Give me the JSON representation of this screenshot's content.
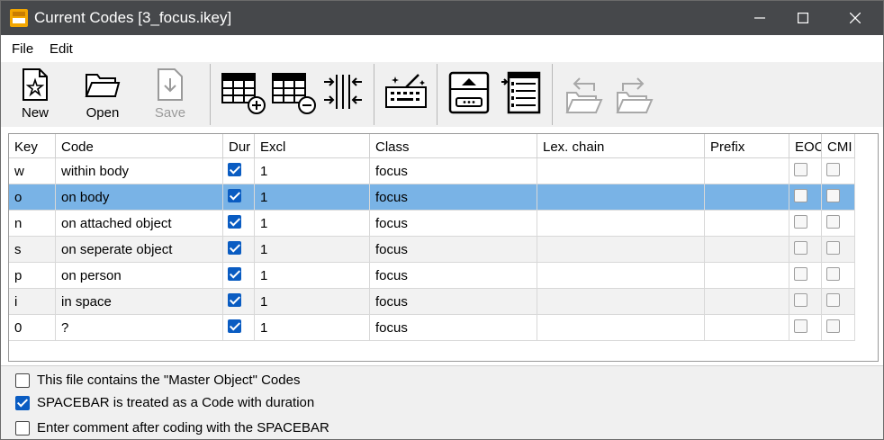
{
  "window": {
    "title": "Current Codes [3_focus.ikey]",
    "controls": [
      "minimize-icon",
      "maximize-icon",
      "close-icon"
    ]
  },
  "menu": {
    "file": "File",
    "edit": "Edit"
  },
  "toolbar": {
    "new": "New",
    "open": "Open",
    "save": "Save",
    "icons": [
      "new-file-star-icon",
      "open-folder-icon",
      "save-download-icon",
      "add-row-grid-icon",
      "remove-row-grid-icon",
      "column-arrows-icon",
      "magic-wand-keyboard-icon",
      "import-box-icon",
      "export-table-icon",
      "undo-folder-icon",
      "redo-folder-icon"
    ]
  },
  "grid": {
    "headers": [
      "Key",
      "Code",
      "Dur",
      "Excl",
      "Class",
      "Lex. chain",
      "Prefix",
      "EOC",
      "CMI"
    ],
    "rows": [
      {
        "key": "w",
        "code": "within body",
        "dur": true,
        "excl": "1",
        "class": "focus",
        "lex": "",
        "prefix": "",
        "eoc": false,
        "cmi": false
      },
      {
        "key": "o",
        "code": "on body",
        "dur": true,
        "excl": "1",
        "class": "focus",
        "lex": "",
        "prefix": "",
        "eoc": false,
        "cmi": false
      },
      {
        "key": "n",
        "code": "on attached object",
        "dur": true,
        "excl": "1",
        "class": "focus",
        "lex": "",
        "prefix": "",
        "eoc": false,
        "cmi": false
      },
      {
        "key": "s",
        "code": "on seperate object",
        "dur": true,
        "excl": "1",
        "class": "focus",
        "lex": "",
        "prefix": "",
        "eoc": false,
        "cmi": false
      },
      {
        "key": "p",
        "code": "on person",
        "dur": true,
        "excl": "1",
        "class": "focus",
        "lex": "",
        "prefix": "",
        "eoc": false,
        "cmi": false
      },
      {
        "key": "i",
        "code": "in space",
        "dur": true,
        "excl": "1",
        "class": "focus",
        "lex": "",
        "prefix": "",
        "eoc": false,
        "cmi": false
      },
      {
        "key": "0",
        "code": "?",
        "dur": true,
        "excl": "1",
        "class": "focus",
        "lex": "",
        "prefix": "",
        "eoc": false,
        "cmi": false
      }
    ],
    "selected_row_key": "o",
    "colors": {
      "selected": "#79b3e6",
      "checkbox": "#0a5cc2"
    }
  },
  "options": [
    {
      "label": "This file contains the \"Master Object\" Codes",
      "checked": false
    },
    {
      "label": "SPACEBAR is treated as a Code with duration",
      "checked": true
    },
    {
      "label": "Enter comment after coding with the SPACEBAR",
      "checked": false
    }
  ]
}
